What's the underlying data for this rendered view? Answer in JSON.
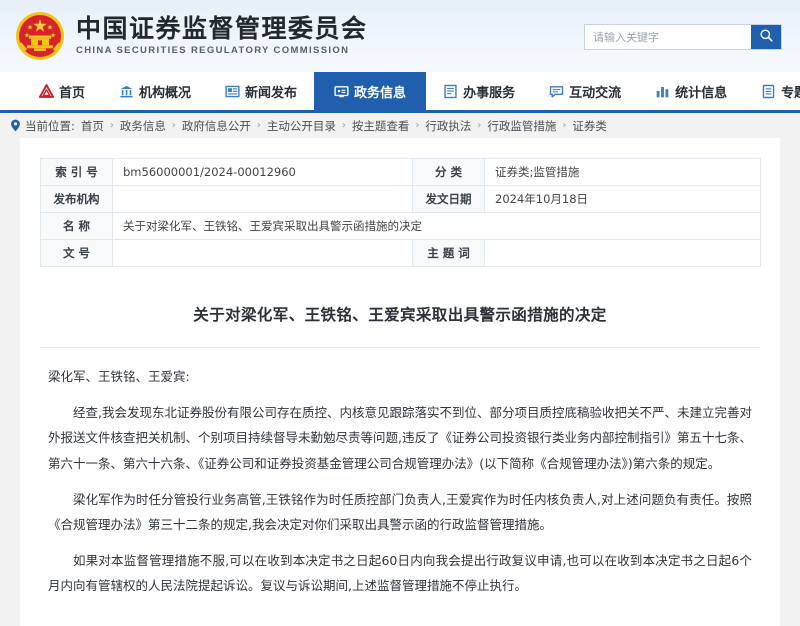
{
  "header": {
    "emblem_icon": "china-national-emblem",
    "title_cn": "中国证券监督管理委员会",
    "title_en": "CHINA SECURITIES REGULATORY COMMISSION",
    "search": {
      "placeholder": "请输入关键字",
      "value": "",
      "button_icon": "search-icon"
    },
    "accent_color": "#1f5fae"
  },
  "nav": {
    "items": [
      {
        "label": "首页",
        "icon": "csrc-logo-icon",
        "active": false
      },
      {
        "label": "机构概况",
        "icon": "bank-icon",
        "active": false
      },
      {
        "label": "新闻发布",
        "icon": "newspaper-icon",
        "active": false
      },
      {
        "label": "政务信息",
        "icon": "monitor-icon",
        "active": true
      },
      {
        "label": "办事服务",
        "icon": "document-list-icon",
        "active": false
      },
      {
        "label": "互动交流",
        "icon": "chat-bubble-icon",
        "active": false
      },
      {
        "label": "统计信息",
        "icon": "bar-chart-icon",
        "active": false
      },
      {
        "label": "专题专栏",
        "icon": "file-icon",
        "active": false
      }
    ]
  },
  "breadcrumb": {
    "icon": "location-pin-icon",
    "label": "当前位置:",
    "separator": "›",
    "items": [
      "首页",
      "政务信息",
      "政府信息公开",
      "主动公开目录",
      "按主题查看",
      "行政执法",
      "行政监管措施",
      "证券类"
    ]
  },
  "meta": {
    "rows": [
      {
        "label1": "索 引 号",
        "value1": "bm56000001/2024-00012960",
        "label2": "分    类",
        "value2": "证券类;监管措施"
      },
      {
        "label1": "发布机构",
        "value1": "",
        "label2": "发文日期",
        "value2": "2024年10月18日"
      },
      {
        "label1": "名    称",
        "value1": "关于对梁化军、王铁铭、王爱宾采取出具警示函措施的决定",
        "label2": null,
        "value2": null
      },
      {
        "label1": "文    号",
        "value1": "",
        "label2": "主 题 词",
        "value2": ""
      }
    ]
  },
  "document": {
    "title": "关于对梁化军、王铁铭、王爱宾采取出具警示函措施的决定",
    "paragraphs": [
      "梁化军、王铁铭、王爱宾:",
      "经查,我会发现东北证券股份有限公司存在质控、内核意见跟踪落实不到位、部分项目质控底稿验收把关不严、未建立完善对外报送文件核查把关机制、个别项目持续督导未勤勉尽责等问题,违反了《证券公司投资银行类业务内部控制指引》第五十七条、第六十一条、第六十六条、《证券公司和证券投资基金管理公司合规管理办法》(以下简称《合规管理办法》)第六条的规定。",
      "梁化军作为时任分管投行业务高管,王铁铭作为时任质控部门负责人,王爱宾作为时任内核负责人,对上述问题负有责任。按照《合规管理办法》第三十二条的规定,我会决定对你们采取出具警示函的行政监督管理措施。",
      "如果对本监督管理措施不服,可以在收到本决定书之日起60日内向我会提出行政复议申请,也可以在收到本决定书之日起6个月内向有管辖权的人民法院提起诉讼。复议与诉讼期间,上述监督管理措施不停止执行。"
    ]
  }
}
